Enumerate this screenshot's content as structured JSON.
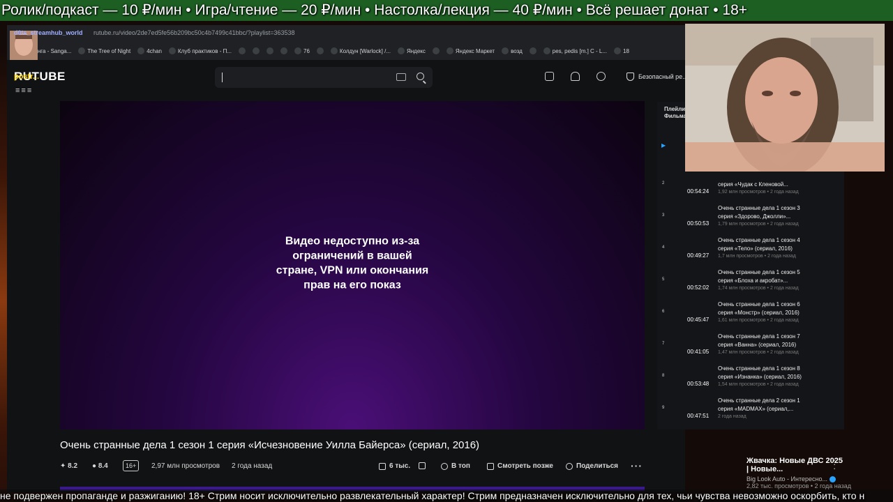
{
  "overlay": {
    "top_ticker": "Ролик/подкаст — 10 ₽/мин • Игра/чтение — 20 ₽/мин • Настолка/лекция — 40 ₽/мин • Всё решает донат • 18+",
    "bottom_ticker": "не подвержен пропаганде и разжиганию! 18+ Стрим носит исключительно развлекательный характер! Стрим предназначен исключительно для тех, чьи чувства невозможно оскорбить, кто н",
    "streamer_tag": "postr...",
    "stream_watermark": "d0ts_streamhub_world"
  },
  "browser": {
    "url": "rutube.ru/video/2de7ed5fe56b209bc50c4b7499c41bbc/?playlist=363538",
    "bookmarks": [
      {
        "label": "Паньчанга - Sanga...",
        "icon": "globe-icon"
      },
      {
        "label": "The Tree of Night",
        "icon": "globe-icon"
      },
      {
        "label": "4chan",
        "icon": "clover-icon"
      },
      {
        "label": "Клуб практиков - П...",
        "icon": "bookmark-icon"
      },
      {
        "label": "",
        "icon": "globe-icon"
      },
      {
        "label": "",
        "icon": "globe-icon"
      },
      {
        "label": "",
        "icon": "globe-icon"
      },
      {
        "label": "",
        "icon": "globe-icon"
      },
      {
        "label": "76",
        "icon": "globe-icon"
      },
      {
        "label": "",
        "icon": "globe-icon"
      },
      {
        "label": "Колдун [Warlock] /...",
        "icon": "bookmark-icon"
      },
      {
        "label": "Яндекс",
        "icon": "globe-icon"
      },
      {
        "label": "",
        "icon": "globe-icon"
      },
      {
        "label": "Яндекс Маркет",
        "icon": "market-icon"
      },
      {
        "label": "возд",
        "icon": "globe-icon"
      },
      {
        "label": "",
        "icon": "bookmark-icon"
      },
      {
        "label": "pes, pedis [m.] C - L...",
        "icon": "bookmark-icon"
      },
      {
        "label": "18",
        "icon": "globe-icon"
      }
    ]
  },
  "site": {
    "logo": "RUTUBE",
    "menu_icon": "hamburger-icon",
    "safe_mode": "Безопасный ре..."
  },
  "player": {
    "message": "Видео недоступно из-за ограничений в вашей стране, VPN или окончания прав на его показ"
  },
  "video": {
    "title": "Очень странные дела 1 сезон 1 серия «Исчезновение Уилла Байерса» (сериал, 2016)",
    "rating1": "8.2",
    "rating2": "8.4",
    "age": "16+",
    "views": "2,97 млн просмотров",
    "date": "2 года назад",
    "likes": "6 тыс.",
    "actions": {
      "top": "В топ",
      "later": "Смотреть позже",
      "share": "Поделиться"
    }
  },
  "playlist": {
    "header_line1": "Плейли...",
    "header_line2": "Фильма...",
    "items": [
      {
        "num": "2",
        "duration": "00:54:24",
        "line1": "",
        "line2": "серия «Чудак с Кленовой...",
        "meta": "1,92 млн просмотров • 2 года назад"
      },
      {
        "num": "3",
        "duration": "00:50:53",
        "line1": "Очень странные дела 1 сезон 3",
        "line2": "серия «Здорово, Джолли»...",
        "meta": "1,79 млн просмотров • 2 года назад"
      },
      {
        "num": "4",
        "duration": "00:49:27",
        "line1": "Очень странные дела 1 сезон 4",
        "line2": "серия «Тело» (сериал, 2016)",
        "meta": "1,7 млн просмотров • 2 года назад"
      },
      {
        "num": "5",
        "duration": "00:52:02",
        "line1": "Очень странные дела 1 сезон 5",
        "line2": "серия «Блоха и акробат»...",
        "meta": "1,74 млн просмотров • 2 года назад"
      },
      {
        "num": "6",
        "duration": "00:45:47",
        "line1": "Очень странные дела 1 сезон 6",
        "line2": "серия «Монстр» (сериал, 2016)",
        "meta": "1,61 млн просмотров • 2 года назад"
      },
      {
        "num": "7",
        "duration": "00:41:05",
        "line1": "Очень странные дела 1 сезон 7",
        "line2": "серия «Ванна» (сериал, 2016)",
        "meta": "1,47 млн просмотров • 2 года назад"
      },
      {
        "num": "8",
        "duration": "00:53:48",
        "line1": "Очень странные дела 1 сезон 8",
        "line2": "серия «Изнанка» (сериал, 2016)",
        "meta": "1,54 млн просмотров • 2 года назад"
      },
      {
        "num": "9",
        "duration": "00:47:51",
        "line1": "Очень странные дела 2 сезон 1",
        "line2": "серия «MADMAX» (сериал,...",
        "meta": "2 года назад"
      }
    ]
  },
  "recommendation": {
    "title": "Жвачка: Новые ДВС 2025 | Новые...",
    "channel": "Big Look Auto - Интересно...",
    "meta": "2,82 тыс. просмотров • 2 года назад"
  }
}
